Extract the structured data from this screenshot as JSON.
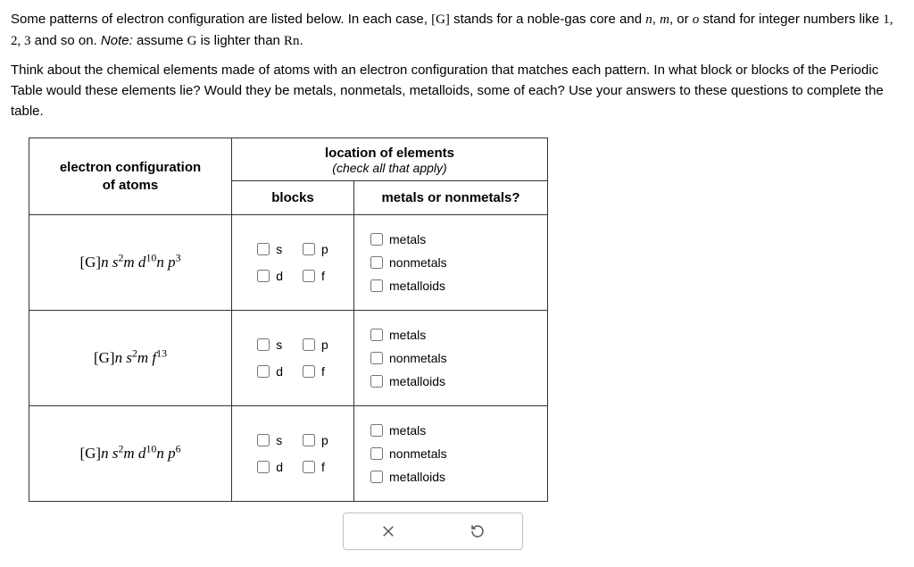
{
  "intro_parts": {
    "p1": "Some patterns of electron configuration are listed below. In each case, ",
    "g_bracket": "[G]",
    "p2": " stands for a noble-gas core and ",
    "n": "n",
    "comma1": ", ",
    "m": "m",
    "comma2": ", or ",
    "o": "o",
    "p3": " stand for integer numbers like ",
    "nums": "1, 2, 3",
    "p4": " and so on. ",
    "note_label": "Note:",
    "note_text": " assume ",
    "G": "G",
    "note_mid": " is lighter than ",
    "Rn": "Rn",
    "period": "."
  },
  "question_text": "Think about the chemical elements made of atoms with an electron configuration that matches each pattern. In what block or blocks of the Periodic Table would these elements lie? Would they be metals, nonmetals, metalloids, some of each? Use your answers to these questions to complete the table.",
  "headers": {
    "ec_line1": "electron configuration",
    "ec_line2": "of atoms",
    "loc_title": "location of elements",
    "loc_sub": "(check all that apply)",
    "blocks": "blocks",
    "mn": "metals or nonmetals?"
  },
  "block_labels": {
    "s": "s",
    "p": "p",
    "d": "d",
    "f": "f"
  },
  "mn_labels": {
    "metals": "metals",
    "nonmetals": "nonmetals",
    "metalloids": "metalloids"
  },
  "rows": [
    {
      "ec": {
        "prefix": "[G]",
        "seq": [
          {
            "base": "n s",
            "sup": "2"
          },
          {
            "base": "m d",
            "sup": "10"
          },
          {
            "base": "n p",
            "sup": "3"
          }
        ]
      }
    },
    {
      "ec": {
        "prefix": "[G]",
        "seq": [
          {
            "base": "n s",
            "sup": "2"
          },
          {
            "base": "m f",
            "sup": "13"
          }
        ]
      }
    },
    {
      "ec": {
        "prefix": "[G]",
        "seq": [
          {
            "base": "n s",
            "sup": "2"
          },
          {
            "base": "m d",
            "sup": "10"
          },
          {
            "base": "n p",
            "sup": "6"
          }
        ]
      }
    }
  ]
}
